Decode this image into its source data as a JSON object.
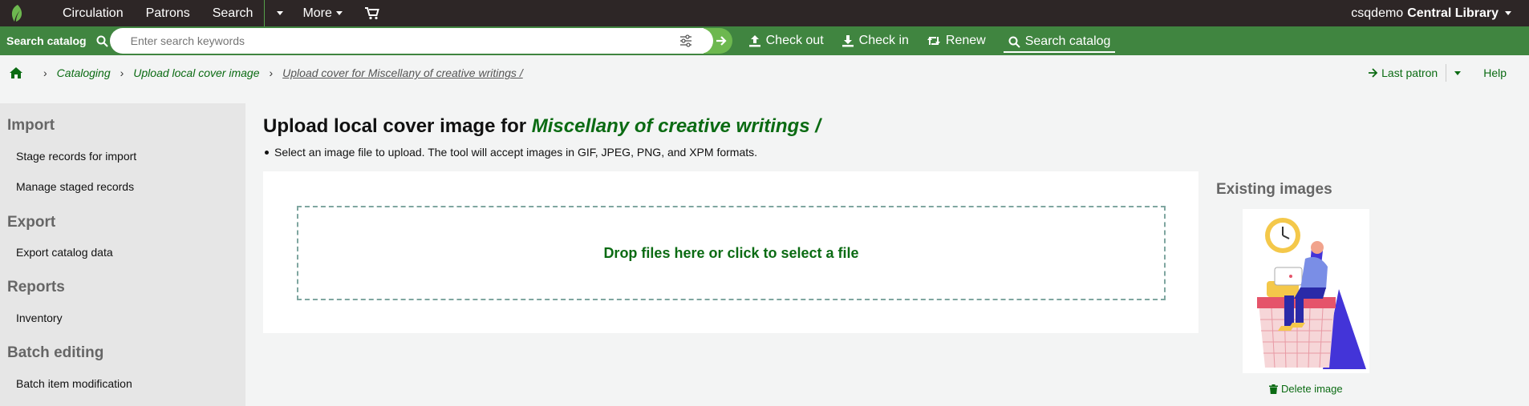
{
  "topnav": {
    "items": [
      "Circulation",
      "Patrons",
      "Search",
      "More"
    ],
    "user": "csqdemo",
    "library": "Central Library"
  },
  "searchbar": {
    "label": "Search catalog",
    "placeholder": "Enter search keywords",
    "quick_links": [
      "Check out",
      "Check in",
      "Renew",
      "Search catalog"
    ]
  },
  "breadcrumbs": {
    "items": [
      "Cataloging",
      "Upload local cover image",
      "Upload cover for Miscellany of creative writings /"
    ],
    "last_patron": "Last patron",
    "help": "Help"
  },
  "sidebar": {
    "sections": [
      {
        "heading": "Import",
        "items": [
          "Stage records for import",
          "Manage staged records"
        ]
      },
      {
        "heading": "Export",
        "items": [
          "Export catalog data"
        ]
      },
      {
        "heading": "Reports",
        "items": [
          "Inventory"
        ]
      },
      {
        "heading": "Batch editing",
        "items": [
          "Batch item modification"
        ]
      }
    ]
  },
  "main": {
    "title_prefix": "Upload local cover image for",
    "record_title": "Miscellany of creative writings /",
    "instruction": "Select an image file to upload. The tool will accept images in GIF, JPEG, PNG, and XPM formats.",
    "dropzone": "Drop files here or click to select a file",
    "existing_heading": "Existing images",
    "delete_label": "Delete image"
  },
  "colors": {
    "topbar": "#2d2626",
    "accent_green": "#408540",
    "link_green": "#0b6b13"
  }
}
